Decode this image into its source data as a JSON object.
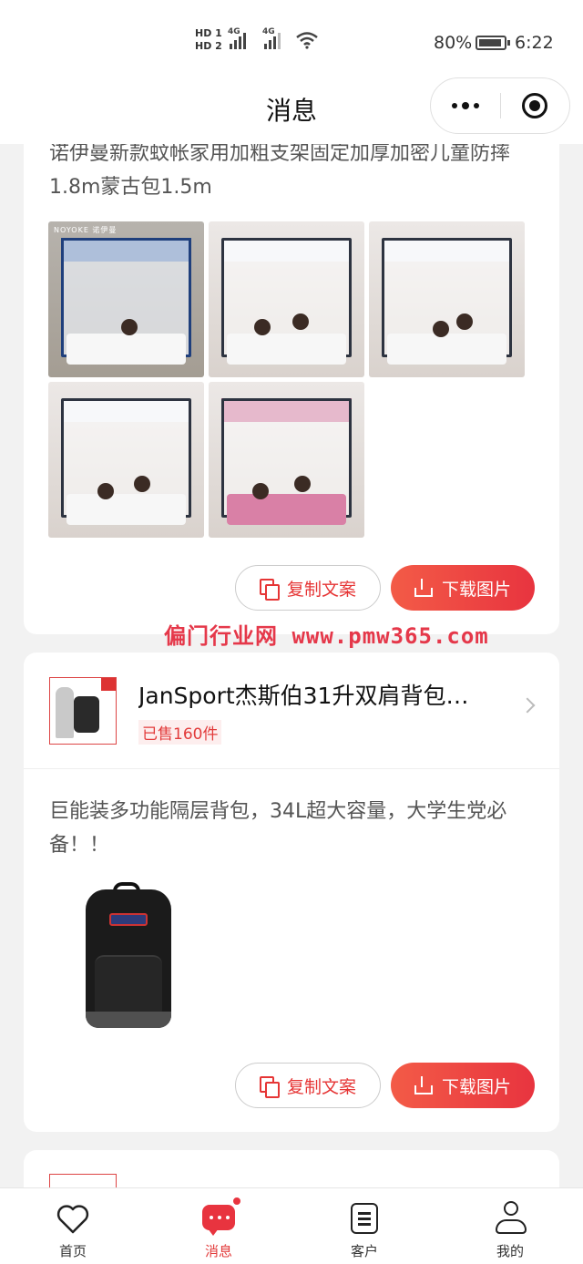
{
  "status_bar": {
    "hd1": "HD 1",
    "hd2": "HD 2",
    "net1": "4G",
    "net2": "4G",
    "battery": "80%",
    "time": "6:22"
  },
  "header": {
    "title": "消息"
  },
  "posts": [
    {
      "text": "诺伊曼新款蚊帐家用加粗支架固定加厚加密儿童防摔1.8m蒙古包1.5m",
      "thumb_brand": "NOYOKE 诺伊曼",
      "copy_label": "复制文案",
      "download_label": "下载图片"
    },
    {
      "product_name": "JanSport杰斯伯31升双肩背包…",
      "sold": "已售160件",
      "text": "巨能装多功能隔层背包，34L超大容量，大学生党必备！！",
      "copy_label": "复制文案",
      "download_label": "下载图片"
    }
  ],
  "watermark": "偏门行业网 www.pmw365.com",
  "tabs": [
    {
      "label": "首页",
      "icon": "heart-icon"
    },
    {
      "label": "消息",
      "icon": "message-icon",
      "active": true
    },
    {
      "label": "客户",
      "icon": "clipboard-icon"
    },
    {
      "label": "我的",
      "icon": "user-icon"
    }
  ],
  "colors": {
    "accent": "#e8343f",
    "background": "#f2f2f2"
  }
}
